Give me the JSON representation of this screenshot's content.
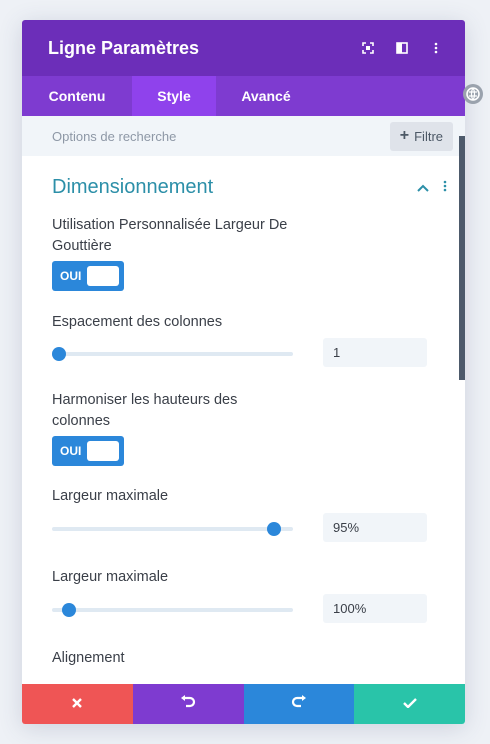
{
  "header": {
    "title": "Ligne Paramètres",
    "icons": [
      "focus-icon",
      "split-view-icon",
      "more-vertical-icon"
    ]
  },
  "tabs": [
    {
      "label": "Contenu",
      "active": false
    },
    {
      "label": "Style",
      "active": true
    },
    {
      "label": "Avancé",
      "active": false
    }
  ],
  "search": {
    "placeholder": "Options de recherche",
    "filter_label": "Filtre",
    "filter_icon": "plus-icon"
  },
  "section": {
    "title": "Dimensionnement",
    "icons": [
      "chevron-up-icon",
      "more-vertical-icon"
    ],
    "fields": {
      "gutter_label": "Utilisation Personnalisée Largeur De Gouttière",
      "gutter_toggle": "OUI",
      "spacing_label": "Espacement des colonnes",
      "spacing_value": "1",
      "spacing_level": 0.03,
      "equal_height_label": "Harmoniser les hauteurs des colonnes",
      "equal_height_toggle": "OUI",
      "max_width_label": "Largeur maximale",
      "max_width_value": "95%",
      "max_width_level": 0.92,
      "max_width2_label": "Largeur maximale",
      "max_width2_value": "100%",
      "max_width2_level": 0.07,
      "alignment_label": "Alignement"
    }
  },
  "footer": {
    "buttons": [
      "cancel-icon",
      "undo-icon",
      "redo-icon",
      "check-icon"
    ]
  },
  "colors": {
    "header_bg": "#6c2eb9",
    "tabs_bg": "#7e3bd0",
    "active_tab": "#8f42ec",
    "accent_blue": "#2b87da",
    "section_title": "#2c8fa8",
    "cancel": "#ef5555",
    "save": "#29c4a9"
  }
}
